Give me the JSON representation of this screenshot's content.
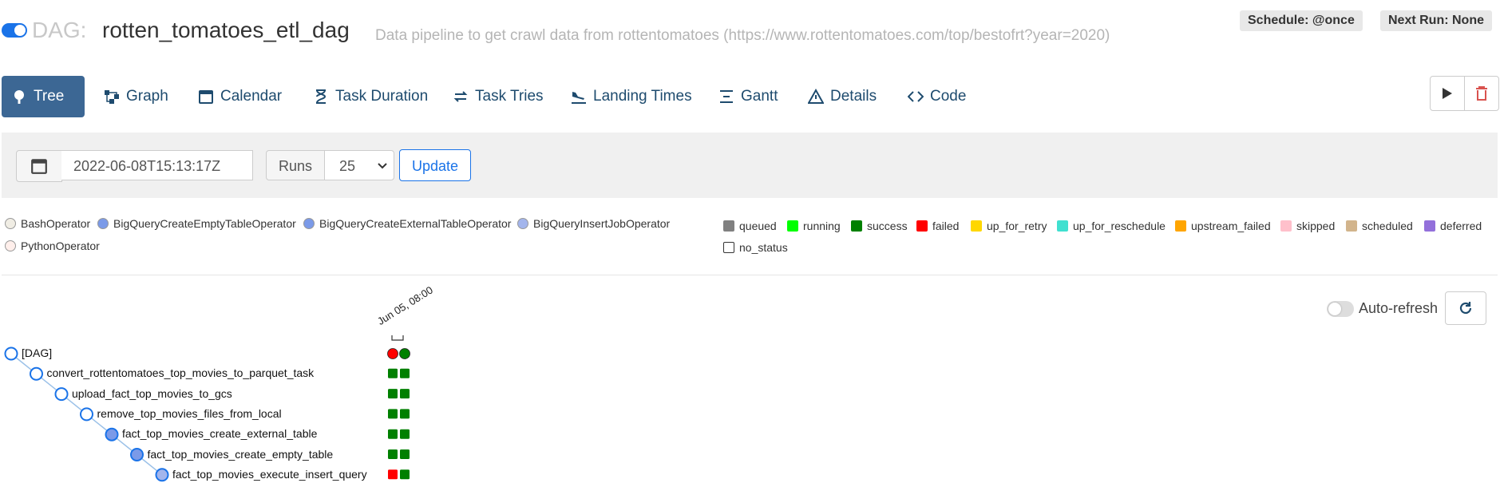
{
  "header": {
    "dag_prefix": "DAG:",
    "dag_id": "rotten_tomatoes_etl_dag",
    "description": "Data pipeline to get crawl data from rottentomatoes (https://www.rottentomatoes.com/top/bestofrt?year=2020)",
    "schedule": "Schedule: @once",
    "next_run": "Next Run: None",
    "paused": false
  },
  "tabs": [
    {
      "label": "Tree",
      "icon": "tree-icon",
      "active": true
    },
    {
      "label": "Graph",
      "icon": "graph-icon"
    },
    {
      "label": "Calendar",
      "icon": "calendar-icon"
    },
    {
      "label": "Task Duration",
      "icon": "hourglass-icon"
    },
    {
      "label": "Task Tries",
      "icon": "retry-arrows-icon"
    },
    {
      "label": "Landing Times",
      "icon": "plane-landing-icon"
    },
    {
      "label": "Gantt",
      "icon": "gantt-icon"
    },
    {
      "label": "Details",
      "icon": "warning-triangle-icon"
    },
    {
      "label": "Code",
      "icon": "code-icon"
    }
  ],
  "filter": {
    "base_date": "2022-06-08T15:13:17Z",
    "runs_label": "Runs",
    "runs_value": "25",
    "update_label": "Update"
  },
  "operators": [
    {
      "name": "BashOperator",
      "color": "#f0ede4"
    },
    {
      "name": "BigQueryCreateEmptyTableOperator",
      "color": "#7b9ae8"
    },
    {
      "name": "BigQueryCreateExternalTableOperator",
      "color": "#7b9ae8"
    },
    {
      "name": "BigQueryInsertJobOperator",
      "color": "#a3b5ec"
    },
    {
      "name": "PythonOperator",
      "color": "#ffefeb"
    }
  ],
  "states": [
    {
      "name": "queued",
      "color": "#808080"
    },
    {
      "name": "running",
      "color": "#00ff00"
    },
    {
      "name": "success",
      "color": "#008000"
    },
    {
      "name": "failed",
      "color": "#ff0000"
    },
    {
      "name": "up_for_retry",
      "color": "#ffd700"
    },
    {
      "name": "up_for_reschedule",
      "color": "#40e0d0"
    },
    {
      "name": "upstream_failed",
      "color": "#ffa500"
    },
    {
      "name": "skipped",
      "color": "#ffc0cb"
    },
    {
      "name": "scheduled",
      "color": "#d2b48c"
    },
    {
      "name": "deferred",
      "color": "#9370db"
    },
    {
      "name": "no_status",
      "color": "#ffffff"
    }
  ],
  "auto_refresh": {
    "label": "Auto-refresh",
    "enabled": false
  },
  "tree": {
    "run_date": "Jun 05, 08:00",
    "dag_runs": [
      "failed",
      "success"
    ],
    "tasks": [
      {
        "name": "[DAG]",
        "fill": "#ffffff",
        "states": null
      },
      {
        "name": "convert_rottentomatoes_top_movies_to_parquet_task",
        "fill": "#ffffff",
        "states": [
          "success",
          "success"
        ]
      },
      {
        "name": "upload_fact_top_movies_to_gcs",
        "fill": "#ffffff",
        "states": [
          "success",
          "success"
        ]
      },
      {
        "name": "remove_top_movies_files_from_local",
        "fill": "#ffffff",
        "states": [
          "success",
          "success"
        ]
      },
      {
        "name": "fact_top_movies_create_external_table",
        "fill": "#7b9ae8",
        "states": [
          "success",
          "success"
        ]
      },
      {
        "name": "fact_top_movies_create_empty_table",
        "fill": "#7b9ae8",
        "states": [
          "success",
          "success"
        ]
      },
      {
        "name": "fact_top_movies_execute_insert_query",
        "fill": "#a3b5ec",
        "states": [
          "failed",
          "success"
        ]
      }
    ]
  }
}
